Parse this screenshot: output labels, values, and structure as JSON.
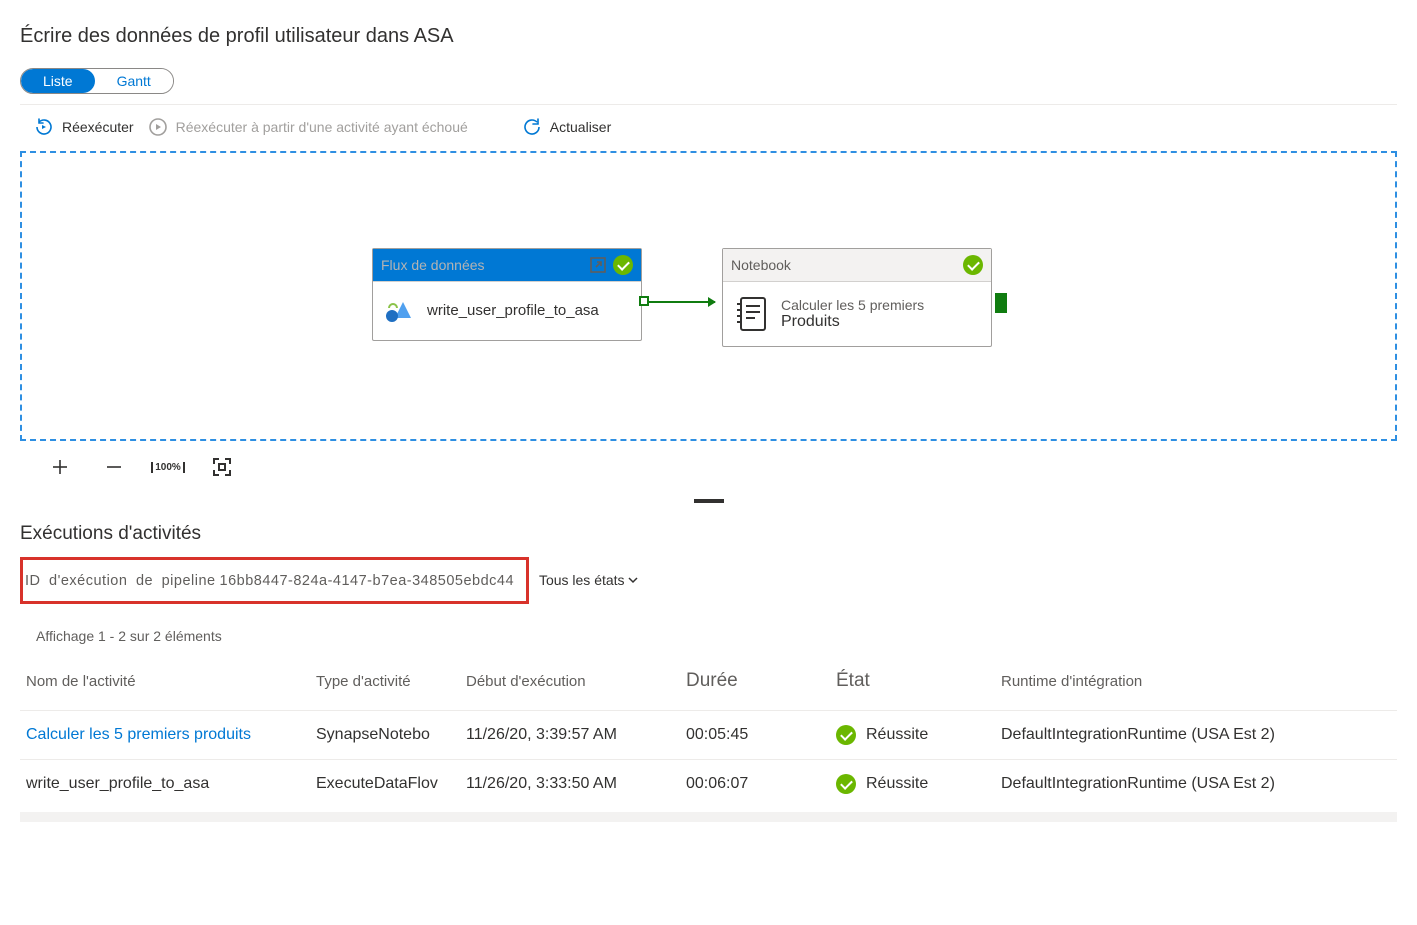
{
  "page_title": "Écrire des données de profil utilisateur dans ASA",
  "view_toggle": {
    "list": "Liste",
    "gantt": "Gantt"
  },
  "toolbar": {
    "rerun": "Réexécuter",
    "rerun_failed": "Réexécuter à partir d'une activité ayant échoué",
    "refresh": "Actualiser"
  },
  "activities": {
    "dataflow": {
      "type": "Flux de données",
      "name": "write_user_profile_to_asa"
    },
    "notebook": {
      "type": "Notebook",
      "sub": "Calculer les 5 premiers",
      "title": "Produits"
    }
  },
  "zoom_label": "100%",
  "section_title": "Exécutions d'activités",
  "run_id_label": "ID d'exécution de pipeline",
  "run_id_value": "16bb8447-824a-4147-b7ea-348505ebdc44",
  "states_filter": "Tous les états",
  "paging": "Affichage 1 -    2 sur 2 éléments",
  "table": {
    "headers": {
      "name": "Nom de l'activité",
      "type": "Type d'activité",
      "start": "Début d'exécution",
      "duration": "Durée",
      "status": "État",
      "runtime": "Runtime d'intégration"
    },
    "rows": [
      {
        "name": "Calculer les 5 premiers produits",
        "type": "SynapseNotebo",
        "start": "11/26/20, 3:39:57 AM",
        "duration": "00:05:45",
        "status": "Réussite",
        "runtime": "DefaultIntegrationRuntime (USA Est 2)"
      },
      {
        "name": "write_user_profile_to_asa",
        "type": "ExecuteDataFlov",
        "start": "11/26/20, 3:33:50 AM",
        "duration": "00:06:07",
        "status": "Réussite",
        "runtime": "DefaultIntegrationRuntime (USA Est 2)"
      }
    ]
  }
}
